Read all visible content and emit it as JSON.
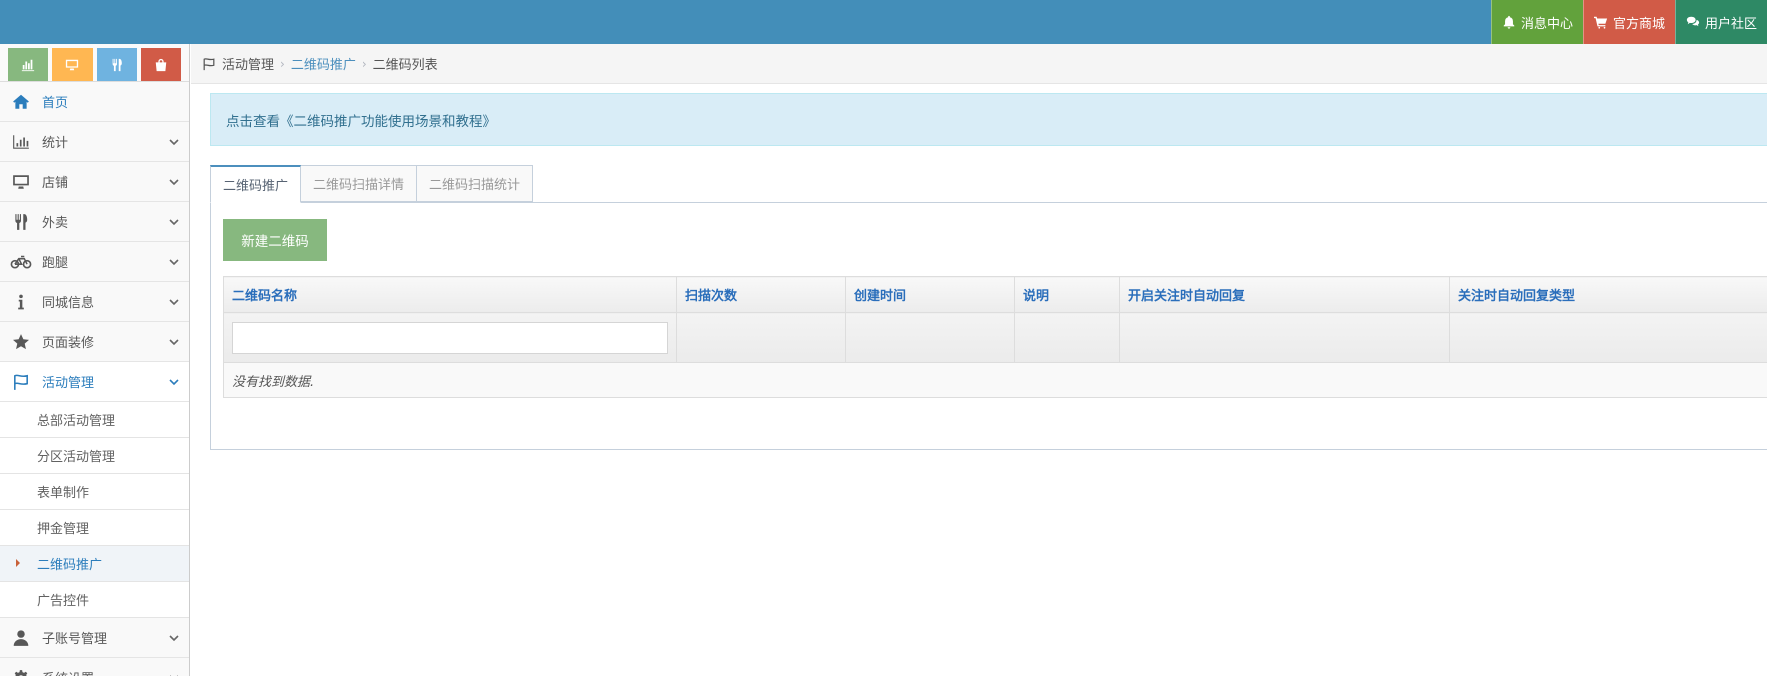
{
  "topbar": {
    "buttons": [
      {
        "label": "消息中心",
        "icon": "bell-icon"
      },
      {
        "label": "官方商城",
        "icon": "cart-icon"
      },
      {
        "label": "用户社区",
        "icon": "comments-icon"
      }
    ]
  },
  "sidebar": {
    "shortcuts": [
      "chart-icon",
      "desktop-icon",
      "utensils-icon",
      "bag-icon"
    ],
    "items": [
      {
        "label": "首页",
        "icon": "home-icon"
      },
      {
        "label": "统计",
        "icon": "bar-chart-icon"
      },
      {
        "label": "店铺",
        "icon": "desktop-icon"
      },
      {
        "label": "外卖",
        "icon": "fork-knife-icon"
      },
      {
        "label": "跑腿",
        "icon": "bicycle-icon"
      },
      {
        "label": "同城信息",
        "icon": "info-icon"
      },
      {
        "label": "页面装修",
        "icon": "star-icon"
      },
      {
        "label": "活动管理",
        "icon": "flag-icon"
      },
      {
        "label": "子账号管理",
        "icon": "user-icon"
      },
      {
        "label": "系统设置",
        "icon": "cog-icon"
      }
    ],
    "sub_items": [
      {
        "label": "总部活动管理"
      },
      {
        "label": "分区活动管理"
      },
      {
        "label": "表单制作"
      },
      {
        "label": "押金管理"
      },
      {
        "label": "二维码推广"
      },
      {
        "label": "广告控件"
      }
    ]
  },
  "breadcrumb": {
    "items": [
      "活动管理",
      "二维码推广",
      "二维码列表"
    ]
  },
  "alert": {
    "text": "点击查看《二维码推广功能使用场景和教程》"
  },
  "tabs": [
    "二维码推广",
    "二维码扫描详情",
    "二维码扫描统计"
  ],
  "toolbar": {
    "new_label": "新建二维码"
  },
  "table": {
    "columns": [
      "二维码名称",
      "扫描次数",
      "创建时间",
      "说明",
      "开启关注时自动回复",
      "关注时自动回复类型"
    ],
    "filter_value": "",
    "empty_text": "没有找到数据."
  },
  "colors": {
    "topbar": "#438eb9",
    "accent": "#2b7dbc",
    "new_button": "#87b87f",
    "msg_btn": "#62a23c",
    "shop_btn": "#d15b47",
    "community_btn": "#2e8965"
  }
}
